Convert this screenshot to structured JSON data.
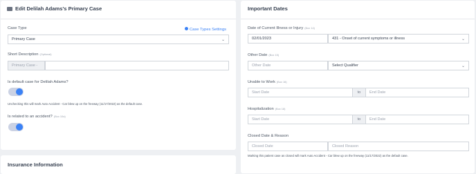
{
  "left": {
    "title": "Edit Delilah Adams's Primary Case",
    "case_type": {
      "label": "Case Type",
      "link": "Case Types Settings",
      "value": "Primary Case"
    },
    "short_description": {
      "label": "Short Description",
      "hint": "(Optional)",
      "prefix": "Primary Case -",
      "value": ""
    },
    "default_case": {
      "label": "Is default case for Delilah Adams?",
      "note": "Unchecking this will mark Auto Accident - Car blew up on the freeway (11/17/2022) as the default case."
    },
    "accident": {
      "label": "Is related to an accident?",
      "hint": "(Box 10a)"
    },
    "insurance_title": "Insurance Information"
  },
  "right": {
    "title": "Important Dates",
    "current_illness": {
      "label": "Date of Current Illness or Injury",
      "hint": "(Box 14)",
      "date": "02/01/2023",
      "qualifier": "431 - Onset of current symptoms or illness"
    },
    "other_date": {
      "label": "Other Date",
      "hint": "(Box 15)",
      "placeholder": "Other Date",
      "qualifier": "Select Qualifier"
    },
    "unable_to_work": {
      "label": "Unable to Work",
      "hint": "(Box 16)",
      "start": "Start Date",
      "to": "to",
      "end": "End Date"
    },
    "hospitalization": {
      "label": "Hospitalization",
      "hint": "(Box 18)",
      "start": "Start Date",
      "to": "to",
      "end": "End Date"
    },
    "closed": {
      "label": "Closed Date & Reason",
      "date_placeholder": "Closed Date",
      "reason_placeholder": "Closed Reason",
      "note": "Marking this patient case as closed will mark Auto Accident - Car blew up on the freeway (11/17/2022) as the default case."
    }
  },
  "colors": {
    "accent": "#3b82f6",
    "toggle_track": "#cbd2e4",
    "background": "#eef0f3"
  },
  "icons": {
    "case": "folder-icon",
    "settings": "gear-icon",
    "chevron": "chevron-down-icon"
  }
}
